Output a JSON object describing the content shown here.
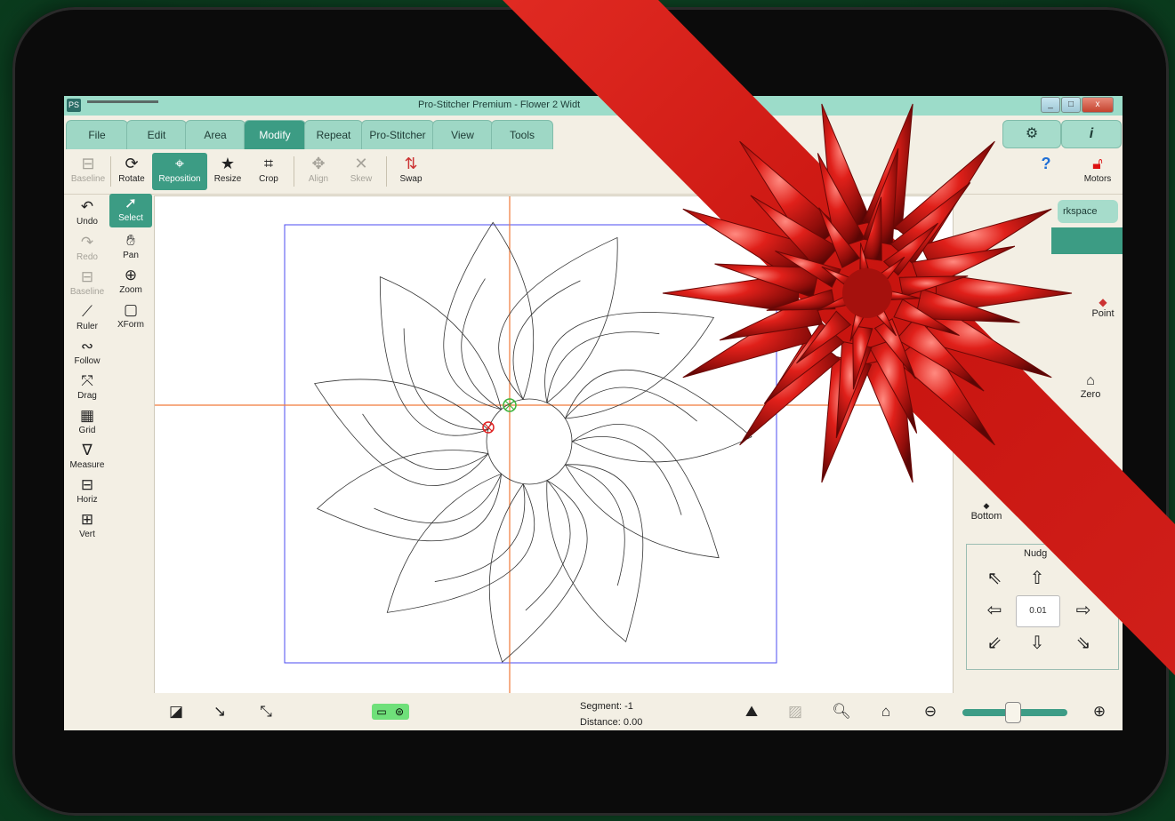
{
  "app": {
    "title": "Pro-Stitcher Premium  -  Flower 2  Widt",
    "logo_text": "PS"
  },
  "window_controls": [
    "_",
    "□",
    "x"
  ],
  "tabs": [
    {
      "label": "File"
    },
    {
      "label": "Edit"
    },
    {
      "label": "Area"
    },
    {
      "label": "Modify",
      "active": true
    },
    {
      "label": "Repeat"
    },
    {
      "label": "Pro-Stitcher"
    },
    {
      "label": "View"
    },
    {
      "label": "Tools"
    }
  ],
  "toolbar": {
    "baseline": "Baseline",
    "rotate": "Rotate",
    "reposition": "Reposition",
    "resize": "Resize",
    "crop": "Crop",
    "align": "Align",
    "skew": "Skew",
    "swap": "Swap",
    "motors": "Motors"
  },
  "left_tools": {
    "undo": "Undo",
    "select": "Select",
    "redo": "Redo",
    "pan": "Pan",
    "baseline": "Baseline",
    "zoom": "Zoom",
    "ruler": "Ruler",
    "xform": "XForm",
    "follow": "Follow",
    "drag": "Drag",
    "grid": "Grid",
    "measure": "Measure",
    "horiz": "Horiz",
    "vert": "Vert"
  },
  "right_panel": {
    "workspace": "rkspace",
    "point": "Point",
    "zero": "Zero",
    "bottom": "Bottom",
    "nudge_title": "Nudg",
    "nudge_value": "0.01"
  },
  "status": {
    "segment": "Segment: -1",
    "distance": "Distance: 0.00"
  },
  "colors": {
    "accent": "#3c9c84",
    "tab": "#9ed7c5",
    "crosshair": "#f07a3a",
    "boundary": "#4b4bf0",
    "ribbon": "#d41f1a"
  }
}
